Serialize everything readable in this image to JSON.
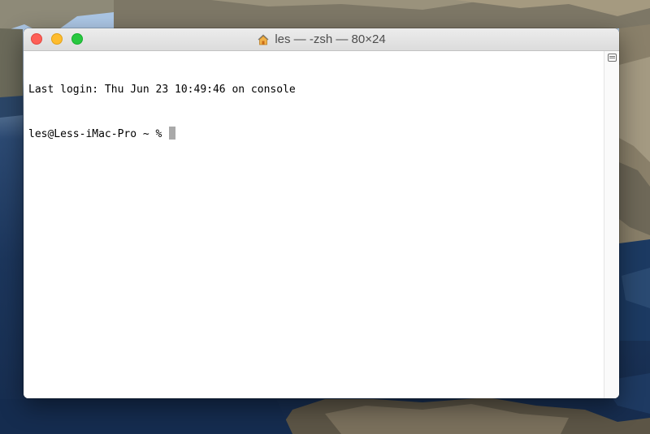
{
  "window": {
    "title": "les — -zsh — 80×24",
    "title_icon": "home-folder-icon"
  },
  "terminal": {
    "last_login": "Last login: Thu Jun 23 10:49:46 on console",
    "prompt": "les@Less-iMac-Pro ~ % "
  },
  "colors": {
    "close": "#fe5f57",
    "minimize": "#febc2e",
    "zoom": "#28c840",
    "cursor": "#a9a9a9"
  }
}
